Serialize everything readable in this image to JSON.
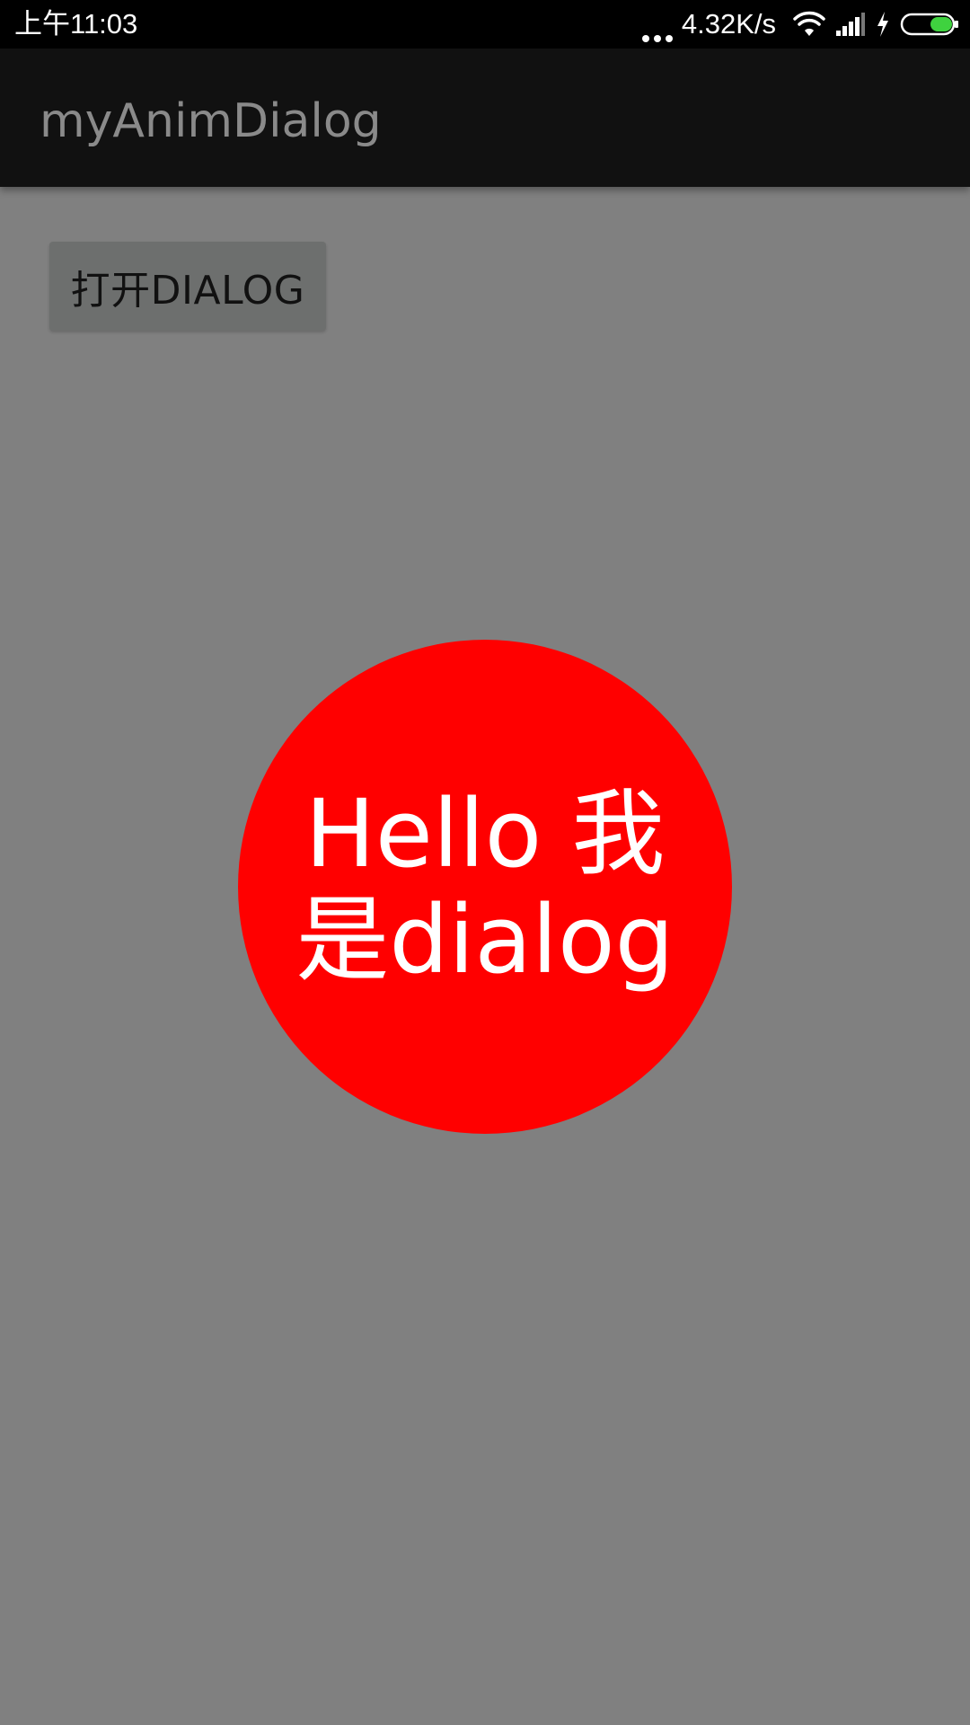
{
  "status_bar": {
    "time": "上午11:03",
    "network_speed": "4.32K/s",
    "icons": [
      "more-dots-icon",
      "wifi-icon",
      "signal-icon",
      "charging-icon",
      "battery-icon"
    ],
    "battery_color": "#3fd23f"
  },
  "app_bar": {
    "title": "myAnimDialog"
  },
  "main": {
    "open_dialog_label": "打开DIALOG"
  },
  "dialog": {
    "text": "Hello 我是dialog",
    "background_color": "#ff0000",
    "text_color": "#ffffff"
  },
  "colors": {
    "background": "#808080",
    "app_bar": "#111111",
    "status_bar": "#000000",
    "button": "#6d6f6e"
  }
}
